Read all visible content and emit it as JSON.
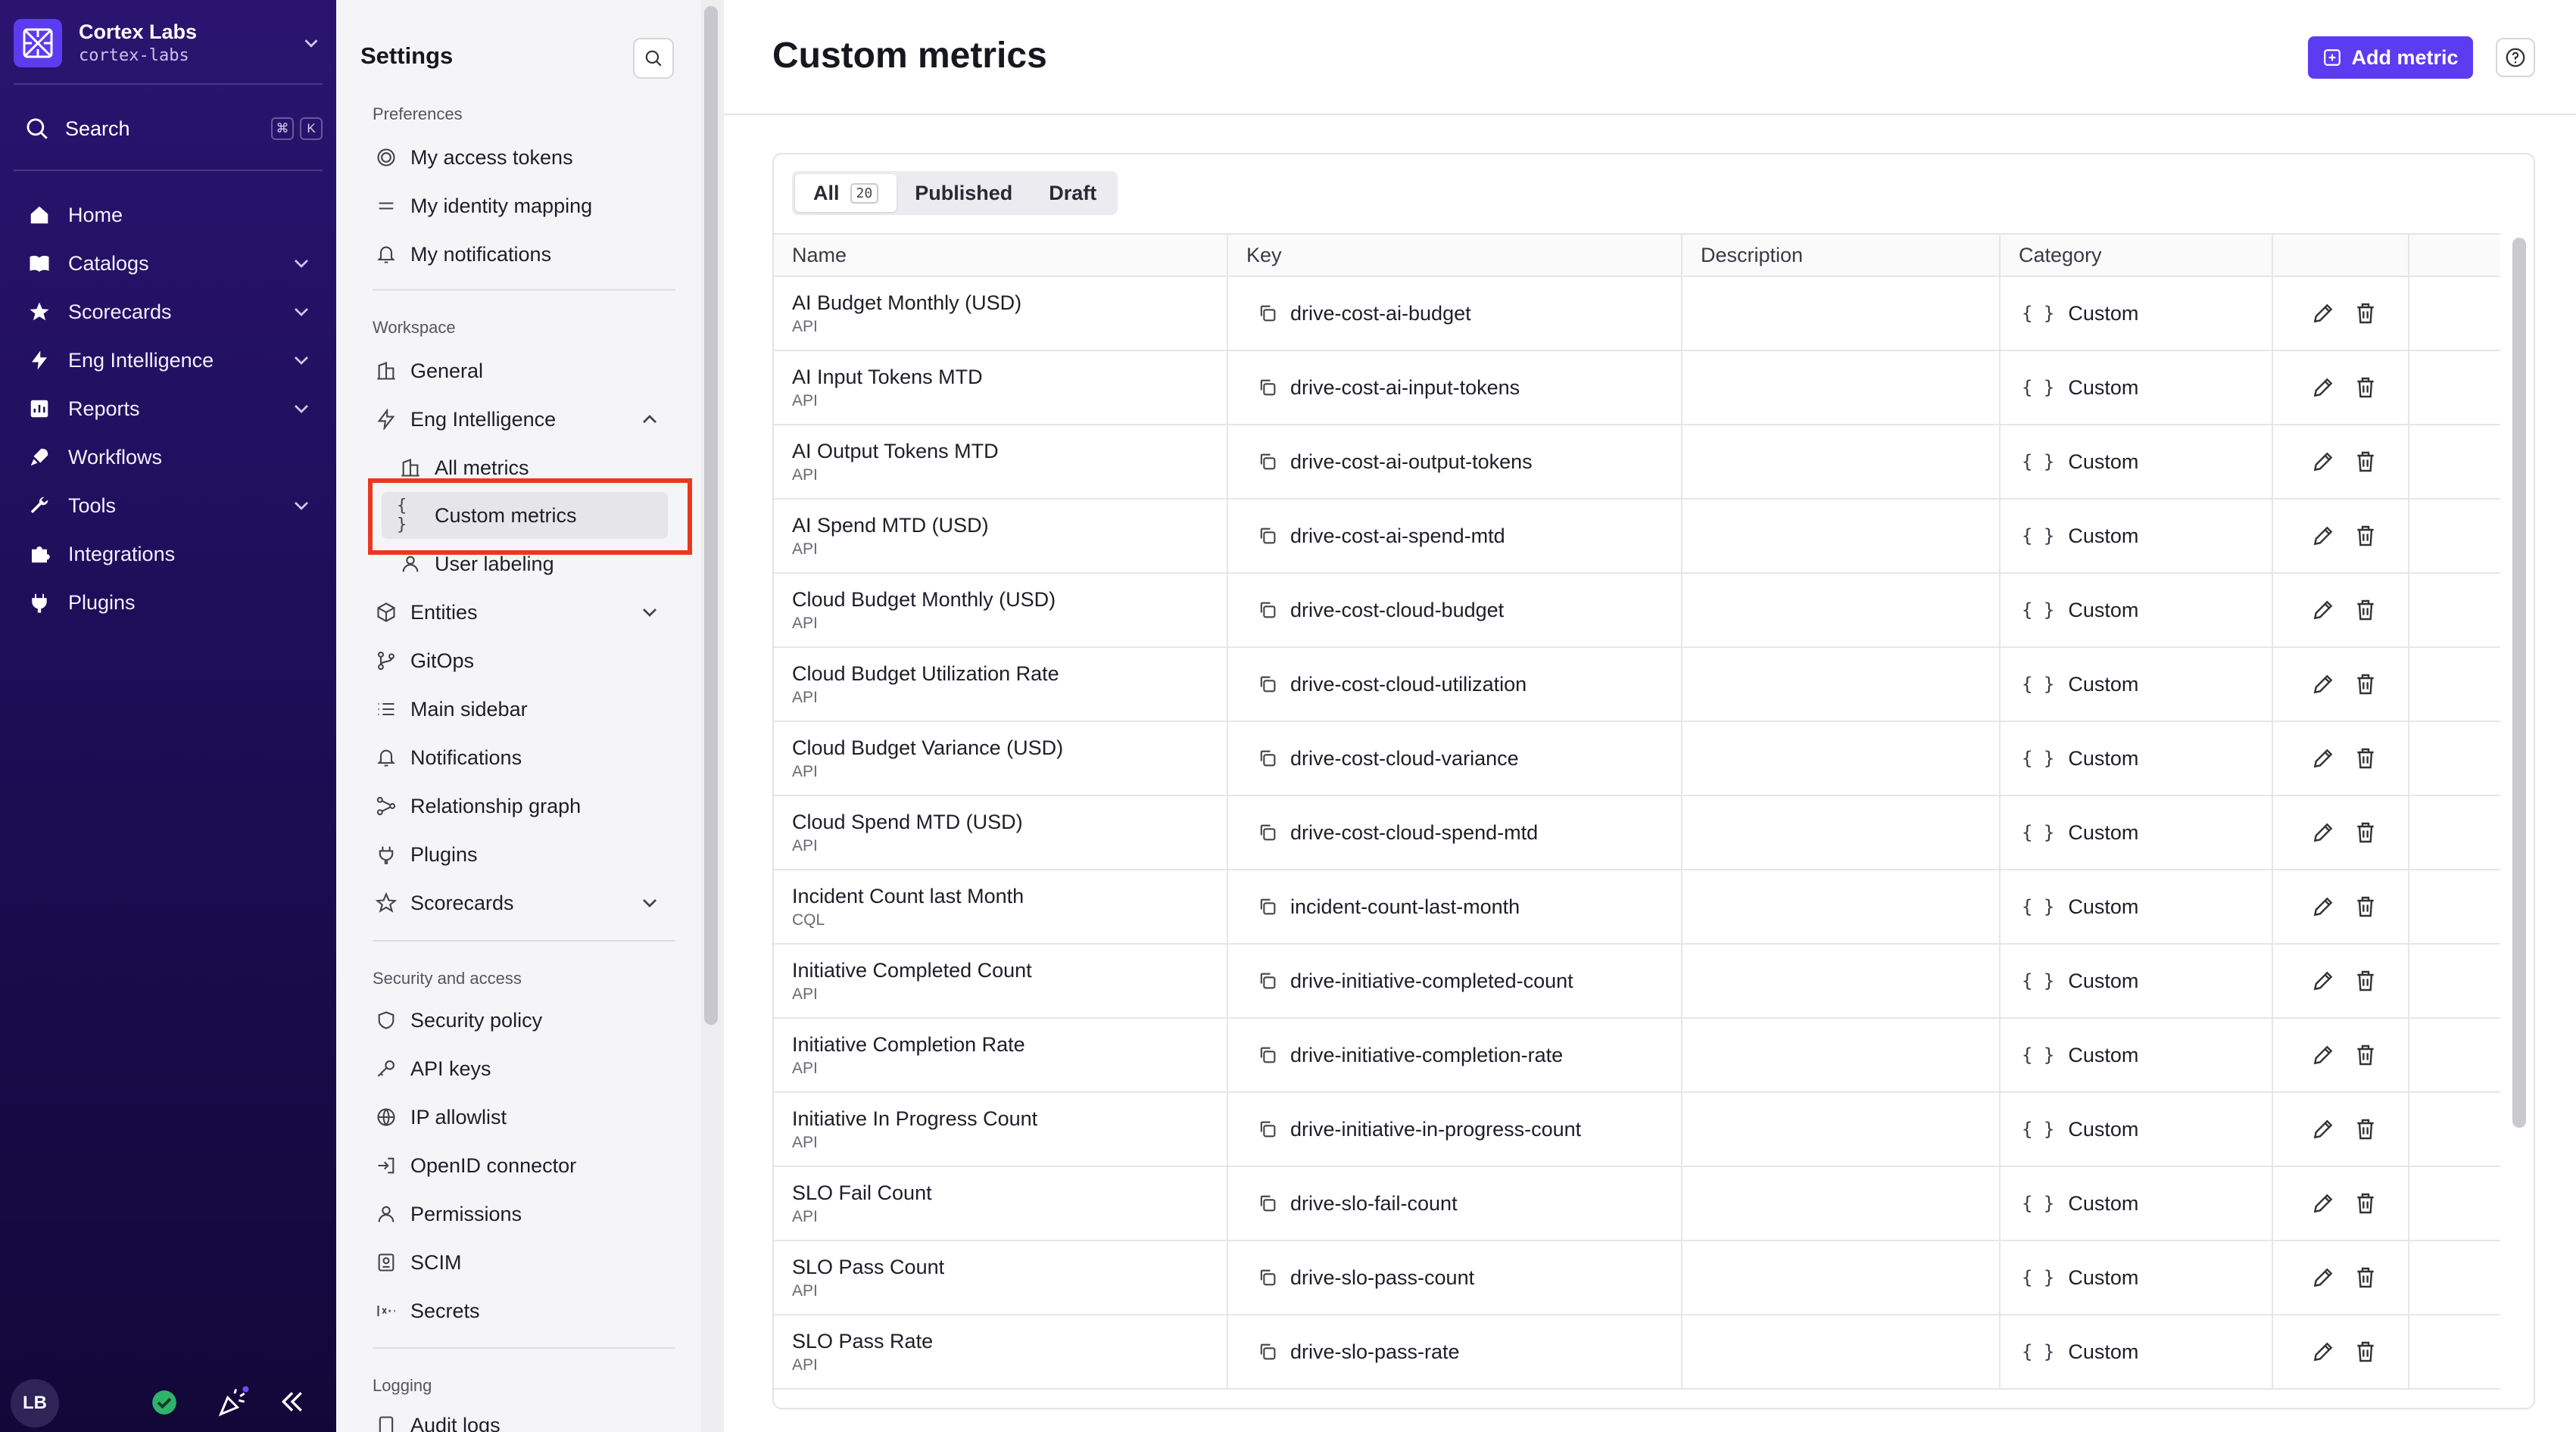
{
  "org": {
    "name": "Cortex Labs",
    "slug": "cortex-labs"
  },
  "nav": {
    "search_label": "Search",
    "shortcut": [
      "⌘",
      "K"
    ],
    "items": [
      {
        "label": "Home",
        "icon": "home-icon",
        "has_chevron": false
      },
      {
        "label": "Catalogs",
        "icon": "catalogs-icon",
        "has_chevron": true
      },
      {
        "label": "Scorecards",
        "icon": "star-icon",
        "has_chevron": true
      },
      {
        "label": "Eng Intelligence",
        "icon": "lightning-icon",
        "has_chevron": true
      },
      {
        "label": "Reports",
        "icon": "reports-icon",
        "has_chevron": true
      },
      {
        "label": "Workflows",
        "icon": "rocket-icon",
        "has_chevron": false
      },
      {
        "label": "Tools",
        "icon": "wrench-icon",
        "has_chevron": true
      },
      {
        "label": "Integrations",
        "icon": "puzzle-icon",
        "has_chevron": false
      },
      {
        "label": "Plugins",
        "icon": "plug-icon",
        "has_chevron": false
      }
    ],
    "user_initials": "LB"
  },
  "settings": {
    "title": "Settings",
    "preferences_head": "Preferences",
    "preferences": [
      "My access tokens",
      "My identity mapping",
      "My notifications"
    ],
    "workspace_head": "Workspace",
    "workspace": {
      "general": "General",
      "eng_intelligence": "Eng Intelligence",
      "all_metrics": "All metrics",
      "custom_metrics": "Custom metrics",
      "user_labeling": "User labeling",
      "entities": "Entities",
      "gitops": "GitOps",
      "main_sidebar": "Main sidebar",
      "notifications": "Notifications",
      "relationship_graph": "Relationship graph",
      "plugins": "Plugins",
      "scorecards": "Scorecards"
    },
    "security_head": "Security and access",
    "security": [
      "Security policy",
      "API keys",
      "IP allowlist",
      "OpenID connector",
      "Permissions",
      "SCIM",
      "Secrets"
    ],
    "logging_head": "Logging",
    "logging": [
      "Audit logs"
    ]
  },
  "main": {
    "title": "Custom metrics",
    "add_button": "Add metric",
    "tabs": [
      {
        "label": "All",
        "count": "20"
      },
      {
        "label": "Published"
      },
      {
        "label": "Draft"
      }
    ],
    "columns": [
      "Name",
      "Key",
      "Description",
      "Category"
    ],
    "rows": [
      {
        "name": "AI Budget Monthly (USD)",
        "source": "API",
        "key": "drive-cost-ai-budget",
        "category": "Custom"
      },
      {
        "name": "AI Input Tokens MTD",
        "source": "API",
        "key": "drive-cost-ai-input-tokens",
        "category": "Custom"
      },
      {
        "name": "AI Output Tokens MTD",
        "source": "API",
        "key": "drive-cost-ai-output-tokens",
        "category": "Custom"
      },
      {
        "name": "AI Spend MTD (USD)",
        "source": "API",
        "key": "drive-cost-ai-spend-mtd",
        "category": "Custom"
      },
      {
        "name": "Cloud Budget Monthly (USD)",
        "source": "API",
        "key": "drive-cost-cloud-budget",
        "category": "Custom"
      },
      {
        "name": "Cloud Budget Utilization Rate",
        "source": "API",
        "key": "drive-cost-cloud-utilization",
        "category": "Custom"
      },
      {
        "name": "Cloud Budget Variance (USD)",
        "source": "API",
        "key": "drive-cost-cloud-variance",
        "category": "Custom"
      },
      {
        "name": "Cloud Spend MTD (USD)",
        "source": "API",
        "key": "drive-cost-cloud-spend-mtd",
        "category": "Custom"
      },
      {
        "name": "Incident Count last Month",
        "source": "CQL",
        "key": "incident-count-last-month",
        "category": "Custom"
      },
      {
        "name": "Initiative Completed Count",
        "source": "API",
        "key": "drive-initiative-completed-count",
        "category": "Custom"
      },
      {
        "name": "Initiative Completion Rate",
        "source": "API",
        "key": "drive-initiative-completion-rate",
        "category": "Custom"
      },
      {
        "name": "Initiative In Progress Count",
        "source": "API",
        "key": "drive-initiative-in-progress-count",
        "category": "Custom"
      },
      {
        "name": "SLO Fail Count",
        "source": "API",
        "key": "drive-slo-fail-count",
        "category": "Custom"
      },
      {
        "name": "SLO Pass Count",
        "source": "API",
        "key": "drive-slo-pass-count",
        "category": "Custom"
      },
      {
        "name": "SLO Pass Rate",
        "source": "API",
        "key": "drive-slo-pass-rate",
        "category": "Custom"
      }
    ],
    "category_icon": "{ }"
  },
  "colors": {
    "accent": "#5b3cf0",
    "highlight": "#e8391f",
    "nav_bg": "#1d0e58"
  }
}
